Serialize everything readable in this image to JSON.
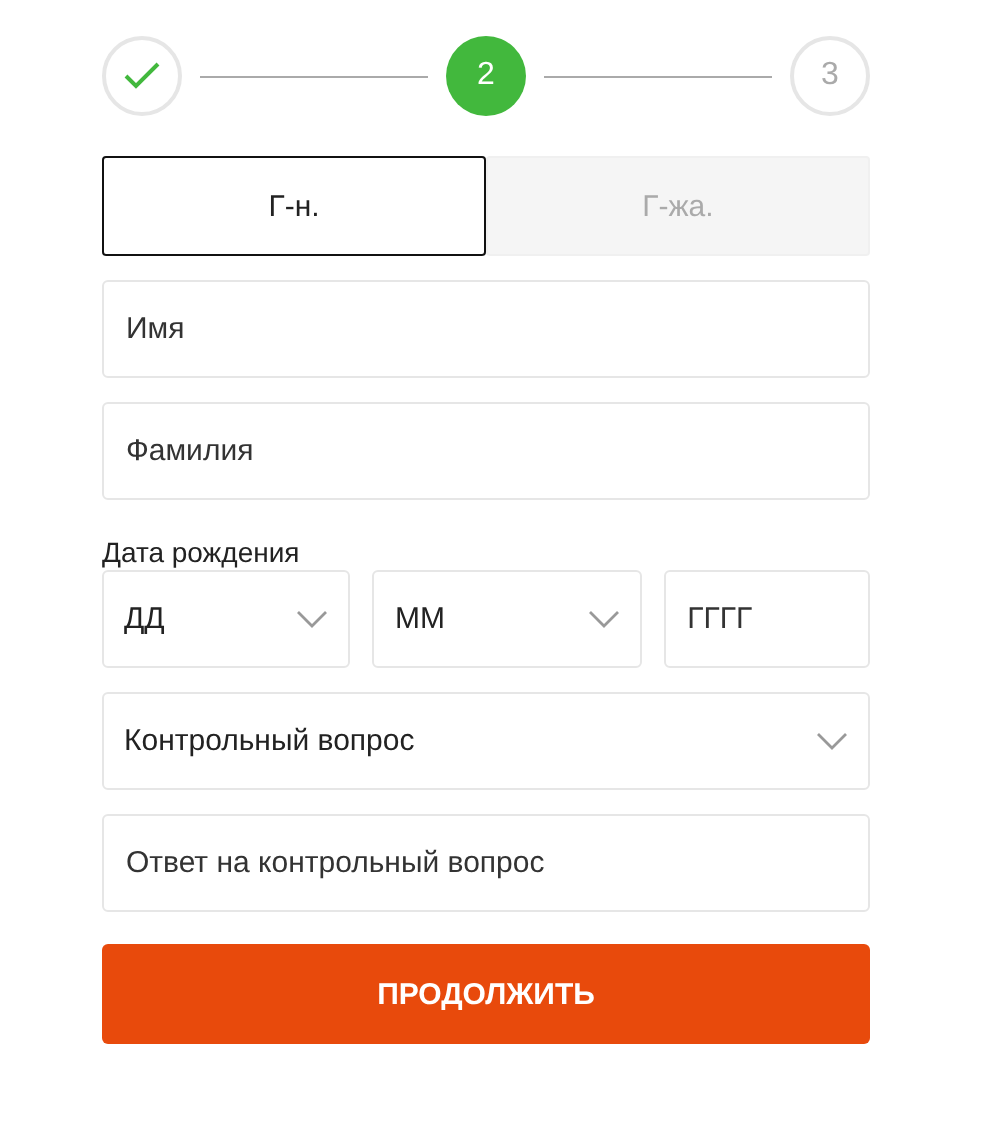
{
  "steps": [
    {
      "kind": "done"
    },
    {
      "kind": "current",
      "label": "2"
    },
    {
      "kind": "todo",
      "label": "3"
    }
  ],
  "gender_tabs": [
    {
      "label": "Г-н.",
      "selected": true
    },
    {
      "label": "Г-жа.",
      "selected": false
    }
  ],
  "name_fields": [
    {
      "placeholder": "Имя"
    },
    {
      "placeholder": "Фамилия"
    }
  ],
  "birth_date": {
    "label": "Дата рождения",
    "parts": [
      {
        "kind": "select",
        "text": "ДД"
      },
      {
        "kind": "select",
        "text": "ММ"
      },
      {
        "kind": "input",
        "placeholder": "ГГГГ"
      }
    ]
  },
  "security_question": {
    "kind": "select",
    "text": "Контрольный вопрос"
  },
  "answer_field": {
    "placeholder": "Ответ на контрольный вопрос"
  },
  "submit_button": "ПРОДОЛЖИТЬ"
}
